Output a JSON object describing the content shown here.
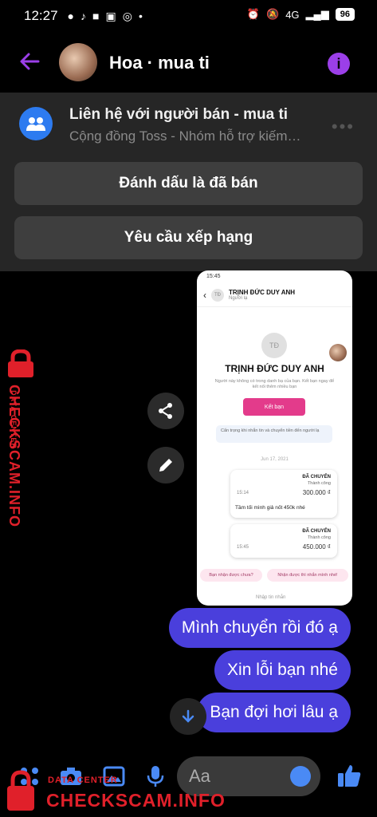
{
  "status_bar": {
    "time": "12:27",
    "network": "4G",
    "battery": "96"
  },
  "header": {
    "title": "Hoa · mua ti"
  },
  "group_panel": {
    "title": "Liên hệ với người bán - mua ti",
    "subtitle": "Cộng đồng Toss - Nhóm hỗ trợ kiếm…",
    "mark_sold_button": "Đánh dấu là đã bán",
    "request_rating_button": "Yêu cầu xếp hạng"
  },
  "embedded_screenshot": {
    "status_time": "15:45",
    "contact_initials": "TĐ",
    "contact_name": "TRỊNH ĐỨC DUY ANH",
    "contact_status": "Người lạ",
    "profile_note": "Người này không có trong danh bạ của bạn. Kết bạn ngay để kết nối thêm nhiều bạn",
    "add_friend_button": "Kết bạn",
    "warning_text": "Cẩn trọng khi nhắn tin và chuyển tiền đến người lạ",
    "date_label": "Jun 17, 2021",
    "cards": [
      {
        "label": "ĐÃ CHUYỂN",
        "status": "Thành công",
        "amount": "300.000 ₫",
        "time": "15:14",
        "message": "Tầm tối mình giả nốt 450k nhé"
      },
      {
        "label": "ĐÃ CHUYỂN",
        "status": "Thành công",
        "amount": "450.000 ₫",
        "time": "15:45"
      }
    ],
    "suggestion_1": "Bạn nhận được chưa?",
    "suggestion_2": "Nhận được thì nhắn mình nhé!",
    "input_placeholder": "Nhập tin nhắn"
  },
  "messages": [
    {
      "text": "Mình chuyển rồi đó ạ"
    },
    {
      "text": "Xin lỗi bạn nhé"
    },
    {
      "text": "Bạn đợi hơi lâu ạ"
    }
  ],
  "composer": {
    "placeholder": "Aa"
  },
  "watermark": {
    "small": "DATA CENTER",
    "big": "CHECKSCAM.INFO"
  }
}
